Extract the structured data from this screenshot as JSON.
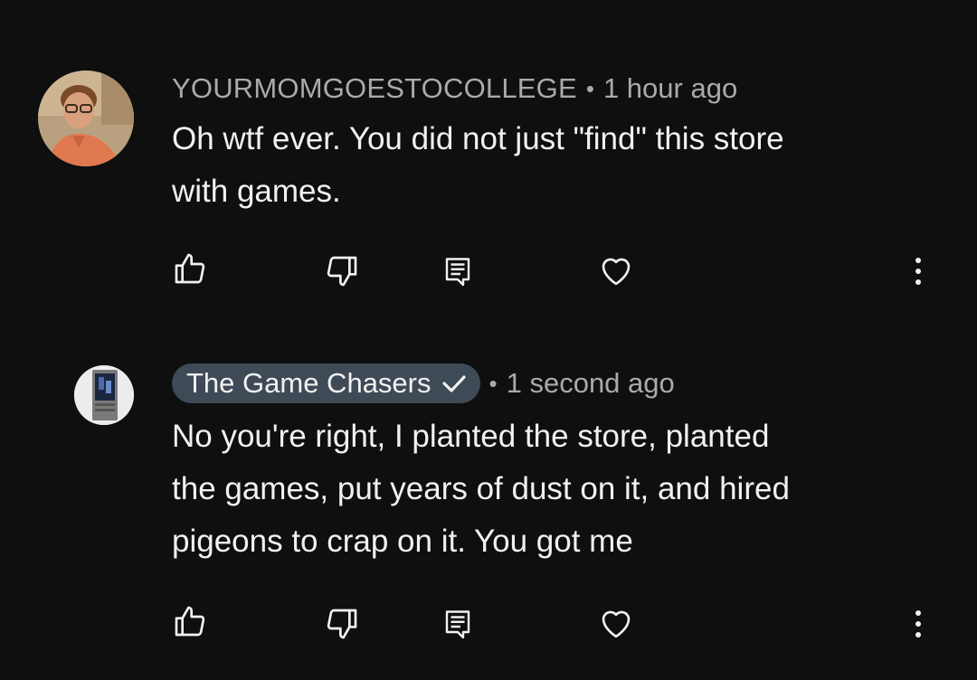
{
  "comments": [
    {
      "author": "YOURMOMGOESTOCOLLEGE",
      "separator": "•",
      "time": "1 hour ago",
      "text_lines": [
        "Oh wtf ever. You did not just \"find\" this store",
        "with games."
      ],
      "avatar_icon": "person-photo-avatar",
      "actions": [
        "like-icon",
        "dislike-icon",
        "reply-icon",
        "heart-icon",
        "more-icon"
      ]
    },
    {
      "author": "The Game Chasers",
      "verified": true,
      "separator": "•",
      "time": "1 second ago",
      "text_lines": [
        "No you're right, I planted the store, planted",
        "the games, put years of dust on it, and hired",
        "pigeons to crap on it. You got me"
      ],
      "avatar_icon": "game-cartridge-avatar",
      "actions": [
        "like-icon",
        "dislike-icon",
        "reply-icon",
        "heart-icon",
        "more-icon"
      ]
    }
  ],
  "colors": {
    "background": "#0f0f0f",
    "text_primary": "#f1f1f1",
    "text_secondary": "#aaaaaa",
    "author_chip_bg": "#3e4a56"
  }
}
